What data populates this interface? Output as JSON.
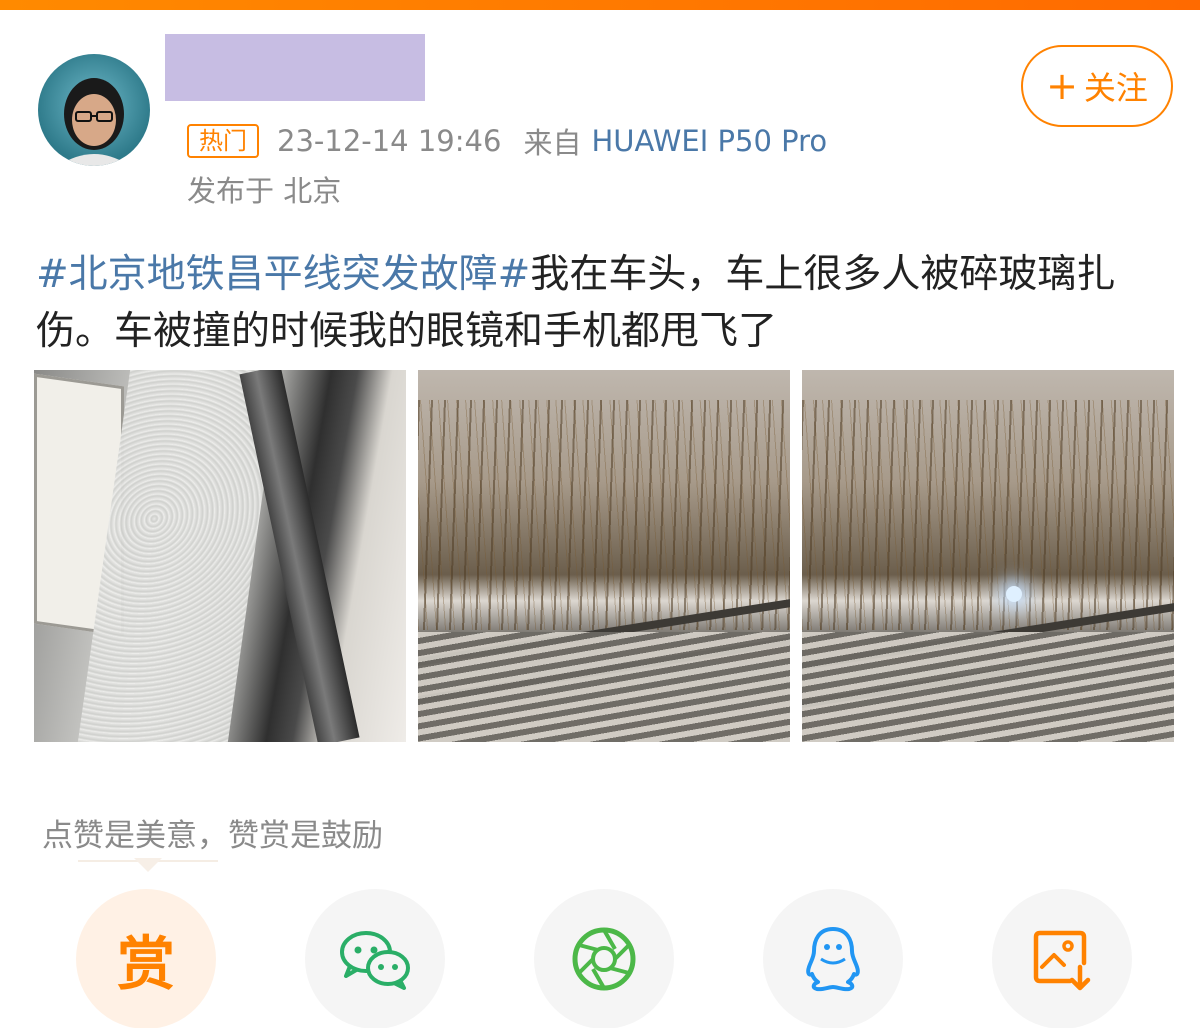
{
  "post": {
    "follow_label": "关注",
    "follow_icon": "plus-icon",
    "hot_badge": "热门",
    "time": "23-12-14 19:46",
    "from_label": "来自",
    "device": "HUAWEI P50 Pro",
    "location": "发布于 北京",
    "hashtag": "#北京地铁昌平线突发故障#",
    "body": "我在车头，车上很多人被碎玻璃扎伤。车被撞的时候我的眼镜和手机都甩飞了",
    "photos": [
      "shattered-train-window",
      "snowy-track-night",
      "snowy-track-night-light"
    ]
  },
  "reward": {
    "hint": "点赞是美意，赞赏是鼓励",
    "button_label": "赏"
  },
  "share": {
    "icons": [
      "wechat-icon",
      "moments-icon",
      "qq-icon",
      "save-image-icon"
    ]
  },
  "colors": {
    "accent": "#ff8200",
    "link": "#4a78a8",
    "meta": "#8a8a8a",
    "wechat": "#2aae67",
    "moments": "#4cb848",
    "qq": "#2196f3"
  }
}
